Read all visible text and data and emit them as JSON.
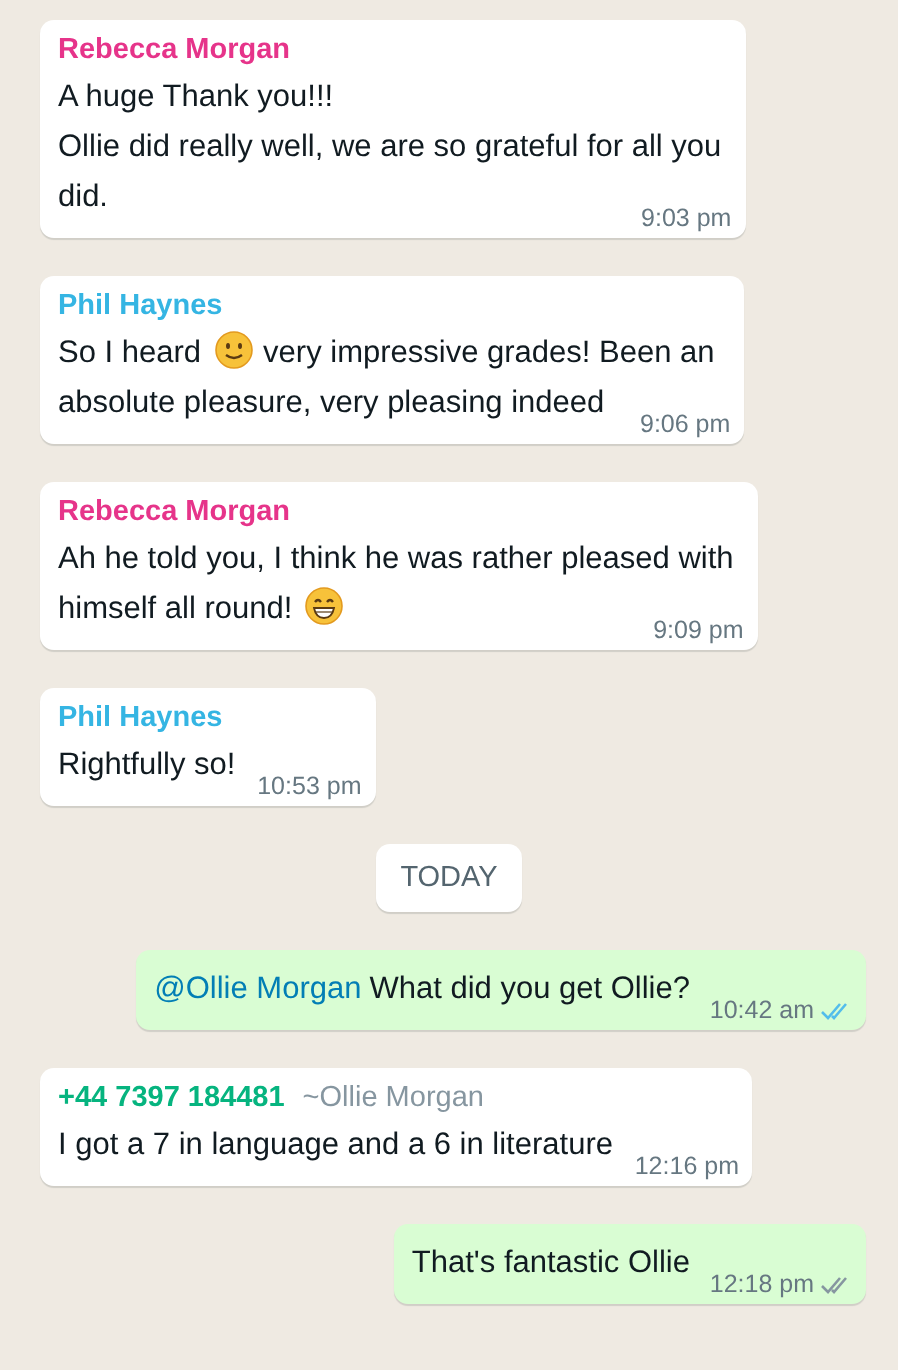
{
  "messages": [
    {
      "kind": "incoming",
      "sender": "Rebecca Morgan",
      "color": "#e6348a",
      "lines": [
        [
          {
            "kind": "text",
            "text": "A huge Thank you!!!"
          }
        ],
        [
          {
            "kind": "text",
            "text": "Ollie did really well, we are so grateful for all you"
          }
        ],
        [
          {
            "kind": "text",
            "text": "did."
          }
        ]
      ],
      "time": "9:03 pm"
    },
    {
      "kind": "incoming",
      "sender": "Phil Haynes",
      "color": "#35b5e3",
      "lines": [
        [
          {
            "kind": "text",
            "text": "So I heard"
          },
          {
            "kind": "smile"
          },
          {
            "kind": "text",
            "text": "very impressive grades! Been an"
          }
        ],
        [
          {
            "kind": "text",
            "text": "absolute pleasure, very pleasing indeed"
          }
        ]
      ],
      "time": "9:06 pm"
    },
    {
      "kind": "incoming",
      "sender": "Rebecca Morgan",
      "color": "#e6348a",
      "lines": [
        [
          {
            "kind": "text",
            "text": "Ah he told you, I think he was rather pleased with"
          }
        ],
        [
          {
            "kind": "text",
            "text": "himself all round!"
          },
          {
            "kind": "grin"
          }
        ]
      ],
      "time": "9:09 pm"
    },
    {
      "kind": "incoming",
      "sender": "Phil Haynes",
      "color": "#35b5e3",
      "lines": [
        [
          {
            "kind": "text",
            "text": "Rightfully so!"
          }
        ]
      ],
      "time": "10:53 pm"
    },
    {
      "kind": "divider",
      "label": "TODAY"
    },
    {
      "kind": "outgoing",
      "lines": [
        [
          {
            "kind": "mention",
            "text": "@Ollie Morgan"
          },
          {
            "kind": "text",
            "text": "What did you get Ollie?"
          }
        ]
      ],
      "time": "10:42 am",
      "read": true
    },
    {
      "kind": "incoming",
      "sender": "+44 7397 184481",
      "color": "#06b47f",
      "alias": "~Ollie Morgan",
      "lines": [
        [
          {
            "kind": "text",
            "text": "I got a 7 in language and a 6 in literature"
          }
        ]
      ],
      "time": "12:16 pm"
    },
    {
      "kind": "outgoing",
      "lines": [
        [
          {
            "kind": "text",
            "text": "That's fantastic Ollie"
          }
        ]
      ],
      "time": "12:18 pm",
      "read": false
    }
  ]
}
